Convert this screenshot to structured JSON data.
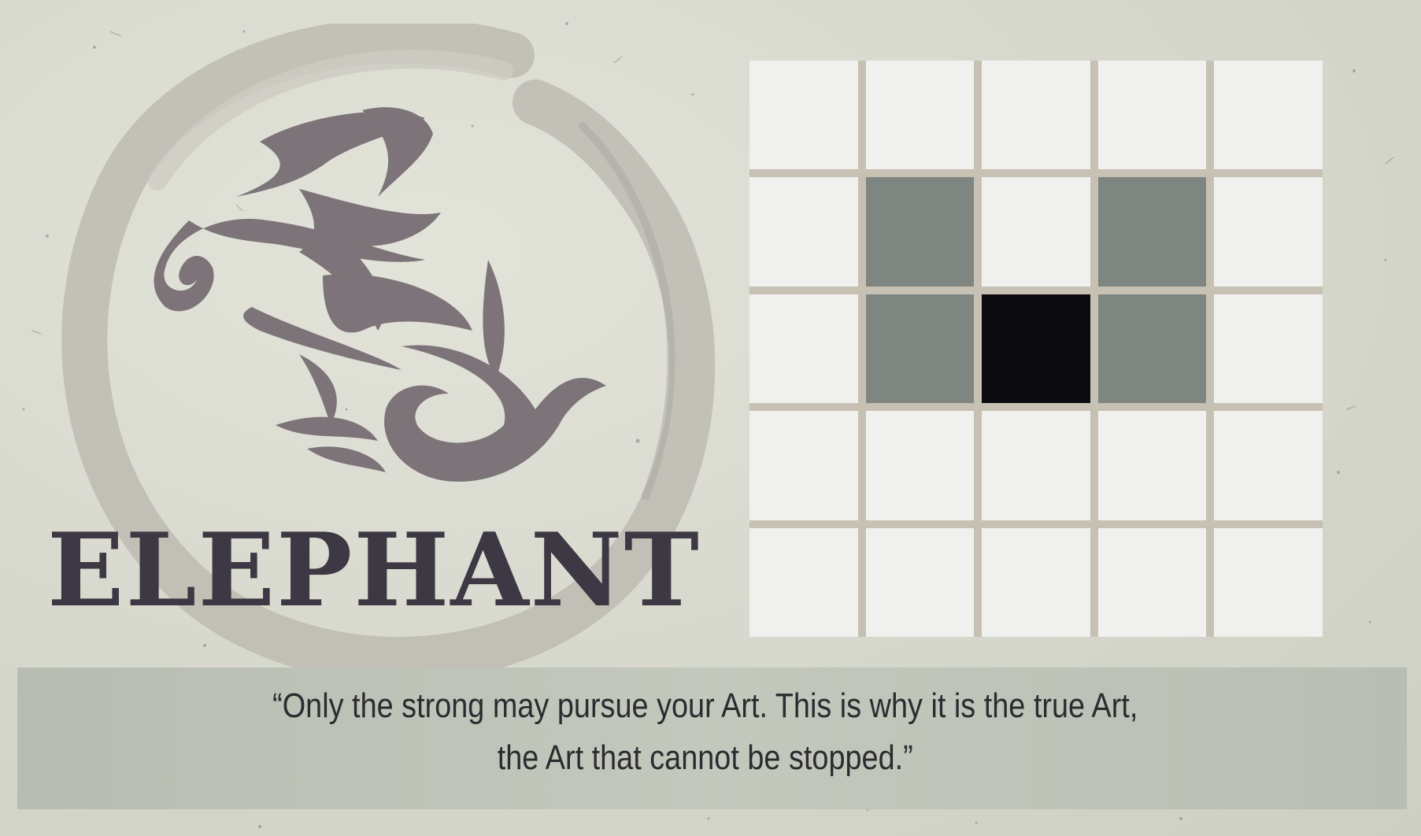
{
  "card": {
    "title": "ELEPHANT",
    "emblem_icon": "elephant-calligraphy-icon",
    "quote": {
      "line1": "“Only the strong may pursue your Art. This is why it is the true Art,",
      "line2": "the Art that cannot be stopped.”"
    }
  },
  "move_grid": {
    "size": 5,
    "rows": [
      [
        "empty",
        "empty",
        "empty",
        "empty",
        "empty"
      ],
      [
        "empty",
        "move",
        "empty",
        "move",
        "empty"
      ],
      [
        "empty",
        "move",
        "piece",
        "move",
        "empty"
      ],
      [
        "empty",
        "empty",
        "empty",
        "empty",
        "empty"
      ],
      [
        "empty",
        "empty",
        "empty",
        "empty",
        "empty"
      ]
    ]
  },
  "colors": {
    "card_background": "#d8d9ce",
    "title_ink": "#3d3843",
    "glyph_ink": "#7d7479",
    "enso_ink": "#b9b6ae",
    "grid_line": "#c7c1b4",
    "empty_cell": "#f0f0ef",
    "move_cell": "#7f8580",
    "piece_cell": "#0c0b0f",
    "quote_band": "#bcc1b6"
  }
}
